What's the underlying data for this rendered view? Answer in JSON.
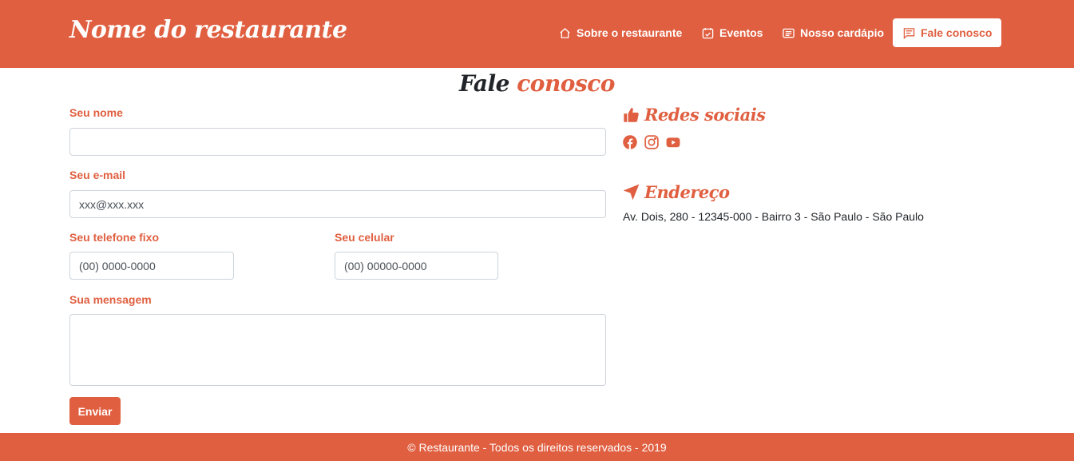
{
  "colors": {
    "accent": "#e05f40",
    "text": "#212529",
    "white": "#ffffff"
  },
  "header": {
    "brand": "Nome do restaurante",
    "nav": [
      {
        "label": "Sobre o restaurante",
        "icon": "home-icon"
      },
      {
        "label": "Eventos",
        "icon": "calendar-check-icon"
      },
      {
        "label": "Nosso cardápio",
        "icon": "card-text-icon"
      },
      {
        "label": "Fale conosco",
        "icon": "chat-icon",
        "active": true
      }
    ]
  },
  "page": {
    "title_part1": "Fale",
    "title_part2": "conosco"
  },
  "form": {
    "name_label": "Seu nome",
    "name_placeholder": "",
    "email_label": "Seu e-mail",
    "email_placeholder": "xxx@xxx.xxx",
    "phone_label": "Seu telefone fixo",
    "phone_placeholder": "(00) 0000-0000",
    "mobile_label": "Seu celular",
    "mobile_placeholder": "(00) 00000-0000",
    "message_label": "Sua mensagem",
    "message_placeholder": "",
    "submit_label": "Enviar"
  },
  "sidebar": {
    "social_title": "Redes sociais",
    "social_icons": [
      "facebook-icon",
      "instagram-icon",
      "youtube-icon"
    ],
    "address_title": "Endereço",
    "address": "Av. Dois, 280 - 12345-000 - Bairro 3 - São Paulo - São Paulo"
  },
  "footer": {
    "text": "© Restaurante - Todos os direitos reservados - 2019"
  }
}
